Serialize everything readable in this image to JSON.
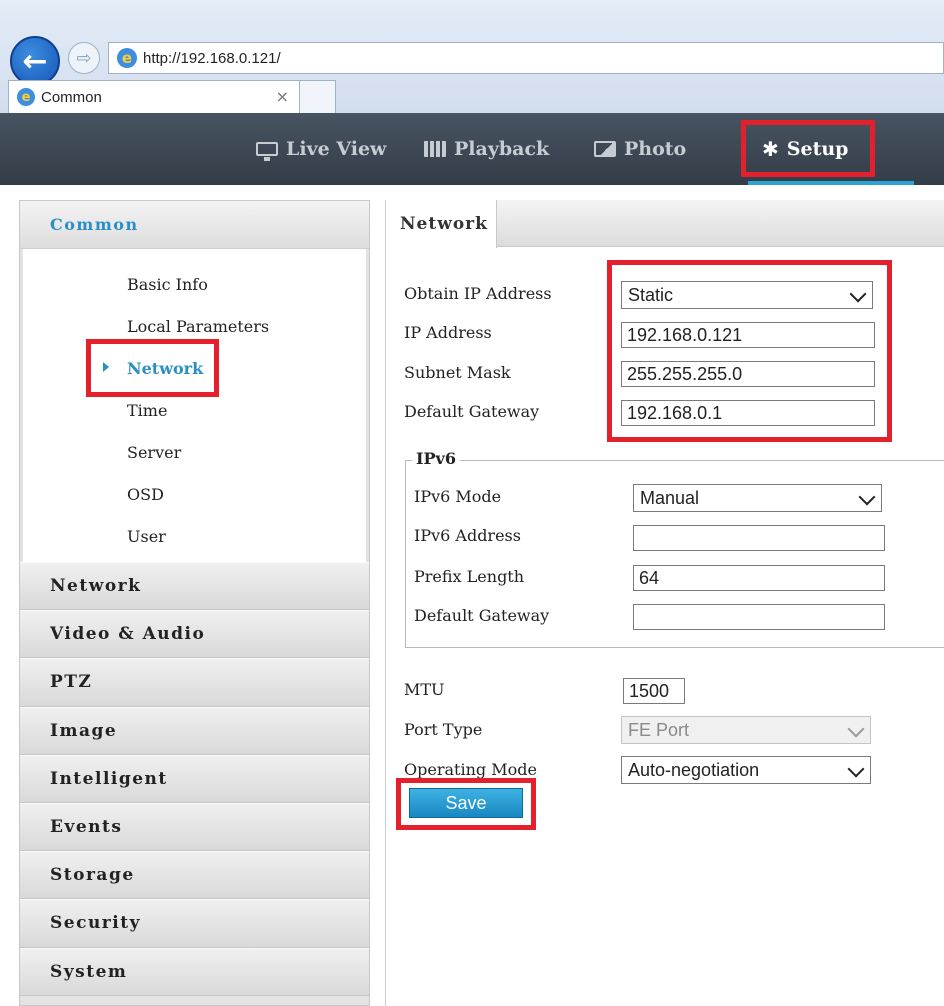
{
  "browser": {
    "url": "http://192.168.0.121/",
    "tab_title": "Common",
    "tab_close": "×",
    "back_glyph": "←",
    "forward_glyph": "⇨",
    "ie_glyph": "e"
  },
  "header": {
    "nav": [
      {
        "label": "Live View",
        "icon": "monitor-icon"
      },
      {
        "label": "Playback",
        "icon": "film-icon"
      },
      {
        "label": "Photo",
        "icon": "photo-icon"
      },
      {
        "label": "Setup",
        "icon": "gear-icon",
        "active": true
      }
    ],
    "gear_glyph": "✱"
  },
  "sidebar": {
    "header": "Common",
    "sub_items": [
      "Basic Info",
      "Local Parameters",
      "Network",
      "Time",
      "Server",
      "OSD",
      "User"
    ],
    "selected_sub_item": "Network",
    "sections": [
      "Network",
      "Video & Audio",
      "PTZ",
      "Image",
      "Intelligent",
      "Events",
      "Storage",
      "Security",
      "System"
    ]
  },
  "content": {
    "tab": "Network",
    "ipv4": {
      "obtain_label": "Obtain IP Address",
      "obtain_value": "Static",
      "ip_label": "IP Address",
      "ip_value": "192.168.0.121",
      "mask_label": "Subnet Mask",
      "mask_value": "255.255.255.0",
      "gateway_label": "Default Gateway",
      "gateway_value": "192.168.0.1"
    },
    "ipv6": {
      "legend": "IPv6",
      "mode_label": "IPv6 Mode",
      "mode_value": "Manual",
      "address_label": "IPv6 Address",
      "address_value": "",
      "prefix_label": "Prefix Length",
      "prefix_value": "64",
      "gateway_label": "Default Gateway",
      "gateway_value": ""
    },
    "mtu_label": "MTU",
    "mtu_value": "1500",
    "port_type_label": "Port Type",
    "port_type_value": "FE Port",
    "operating_mode_label": "Operating Mode",
    "operating_mode_value": "Auto-negotiation",
    "save_label": "Save"
  },
  "colors": {
    "accent": "#2a8fc4",
    "highlight_box": "#e3202b",
    "header_bg": "#3d4752",
    "save_button": "#1e96cf"
  }
}
